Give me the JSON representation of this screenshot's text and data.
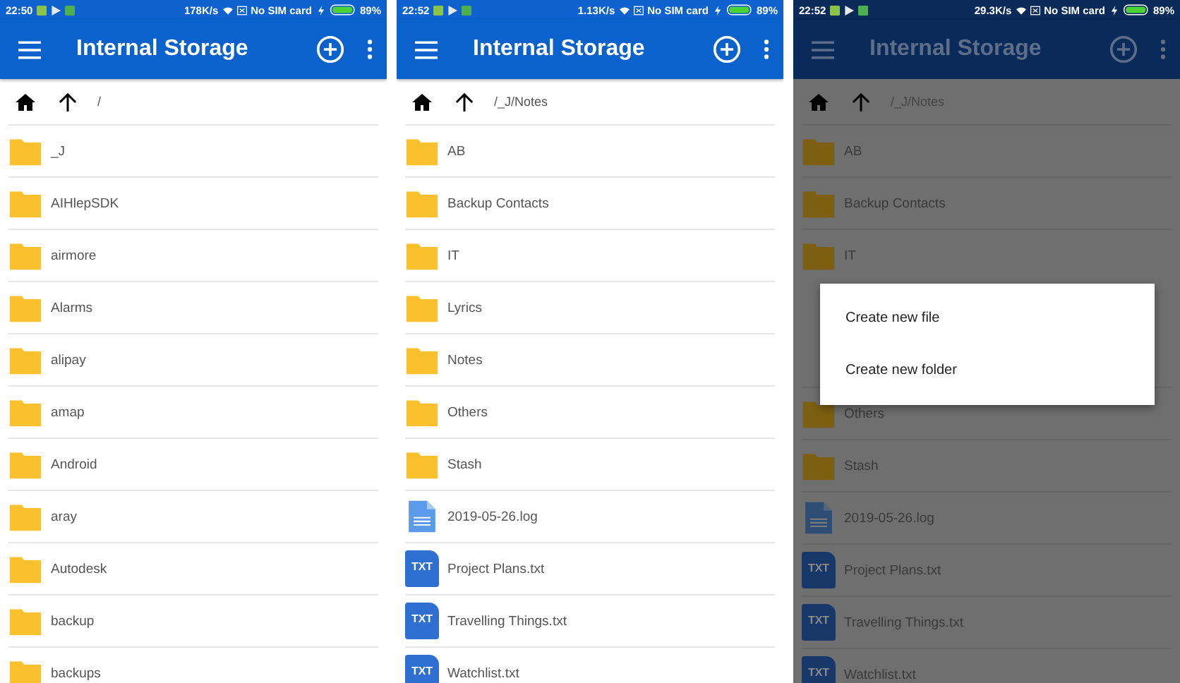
{
  "screens": [
    {
      "dimmed": false,
      "status_bar": {
        "time": "22:50",
        "speed": "178K/s",
        "carrier": "No SIM card",
        "battery": "89%"
      },
      "app_bar": {
        "title": "Internal Storage"
      },
      "path": "/",
      "items": [
        {
          "kind": "folder",
          "name": "_J"
        },
        {
          "kind": "folder",
          "name": "AIHlepSDK"
        },
        {
          "kind": "folder",
          "name": "airmore"
        },
        {
          "kind": "folder",
          "name": "Alarms"
        },
        {
          "kind": "folder",
          "name": "alipay"
        },
        {
          "kind": "folder",
          "name": "amap"
        },
        {
          "kind": "folder",
          "name": "Android"
        },
        {
          "kind": "folder",
          "name": "aray"
        },
        {
          "kind": "folder",
          "name": "Autodesk"
        },
        {
          "kind": "folder",
          "name": "backup"
        },
        {
          "kind": "folder",
          "name": "backups"
        }
      ]
    },
    {
      "dimmed": false,
      "status_bar": {
        "time": "22:52",
        "speed": "1.13K/s",
        "carrier": "No SIM card",
        "battery": "89%"
      },
      "app_bar": {
        "title": "Internal Storage"
      },
      "path": "/_J/Notes",
      "items": [
        {
          "kind": "folder",
          "name": "AB"
        },
        {
          "kind": "folder",
          "name": "Backup Contacts"
        },
        {
          "kind": "folder",
          "name": "IT"
        },
        {
          "kind": "folder",
          "name": "Lyrics"
        },
        {
          "kind": "folder",
          "name": "Notes"
        },
        {
          "kind": "folder",
          "name": "Others"
        },
        {
          "kind": "folder",
          "name": "Stash"
        },
        {
          "kind": "log",
          "name": "2019-05-26.log"
        },
        {
          "kind": "txt",
          "badge": "TXT",
          "name": "Project Plans.txt"
        },
        {
          "kind": "txt",
          "badge": "TXT",
          "name": "Travelling Things.txt"
        },
        {
          "kind": "txt",
          "badge": "TXT",
          "name": "Watchlist.txt"
        }
      ]
    },
    {
      "dimmed": true,
      "status_bar": {
        "time": "22:52",
        "speed": "29.3K/s",
        "carrier": "No SIM card",
        "battery": "89%"
      },
      "app_bar": {
        "title": "Internal Storage"
      },
      "path": "/_J/Notes",
      "items": [
        {
          "kind": "folder",
          "name": "AB"
        },
        {
          "kind": "folder",
          "name": "Backup Contacts"
        },
        {
          "kind": "folder",
          "name": "IT"
        }
      ],
      "menu": {
        "items": [
          "Create new file",
          "Create new folder"
        ]
      },
      "items_below_menu": [
        {
          "kind": "folder",
          "name": "Others"
        },
        {
          "kind": "folder",
          "name": "Stash"
        },
        {
          "kind": "log",
          "name": "2019-05-26.log"
        },
        {
          "kind": "txt",
          "badge": "TXT",
          "name": "Project Plans.txt"
        },
        {
          "kind": "txt",
          "badge": "TXT",
          "name": "Travelling Things.txt"
        },
        {
          "kind": "txt",
          "badge": "TXT",
          "name": "Watchlist.txt"
        }
      ]
    }
  ]
}
